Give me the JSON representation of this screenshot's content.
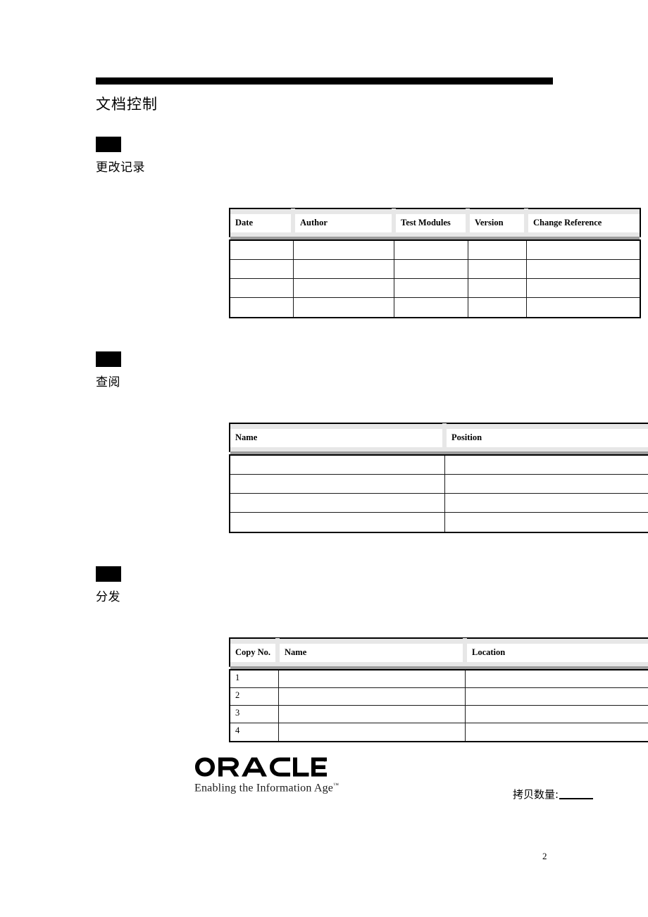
{
  "page": {
    "title": "文档控制",
    "page_number": "2",
    "rule_color": "#000000",
    "header_fill": "#e7e7e7"
  },
  "sections": [
    {
      "id": "change-record",
      "label": "更改记录",
      "table": {
        "columns": [
          "Date",
          "Author",
          "Test Modules",
          "Version",
          "Change Reference"
        ],
        "rows": [
          [
            "",
            "",
            "",
            "",
            ""
          ],
          [
            "",
            "",
            "",
            "",
            ""
          ],
          [
            "",
            "",
            "",
            "",
            ""
          ],
          [
            "",
            "",
            "",
            "",
            ""
          ]
        ]
      }
    },
    {
      "id": "review",
      "label": "查阅",
      "table": {
        "columns": [
          "Name",
          "Position"
        ],
        "rows": [
          [
            "",
            ""
          ],
          [
            "",
            ""
          ],
          [
            "",
            ""
          ],
          [
            "",
            ""
          ]
        ]
      }
    },
    {
      "id": "distribution",
      "label": "分发",
      "table": {
        "columns": [
          "Copy No.",
          "Name",
          "Location"
        ],
        "rows": [
          [
            "1",
            "",
            ""
          ],
          [
            "2",
            "",
            ""
          ],
          [
            "3",
            "",
            ""
          ],
          [
            "4",
            "",
            ""
          ]
        ]
      }
    }
  ],
  "footer": {
    "logo_wordmark": "ORACLE",
    "logo_registered": "®",
    "logo_tagline": "Enabling the Information Age",
    "logo_tagline_tm": "™",
    "copies_label": "拷贝数量:",
    "copies_value": ""
  }
}
